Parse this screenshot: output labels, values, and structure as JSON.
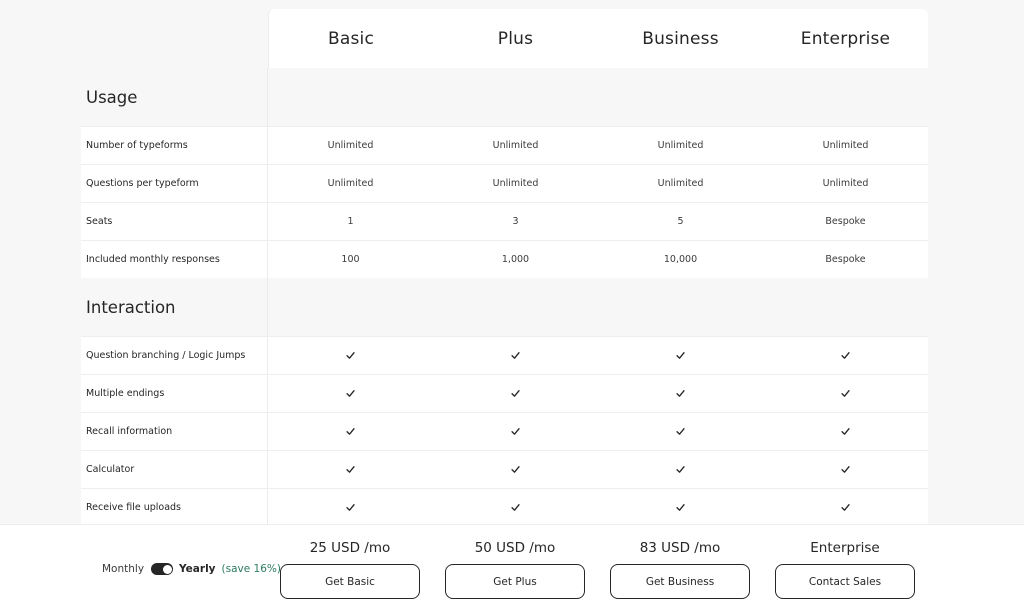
{
  "plans": [
    "Basic",
    "Plus",
    "Business",
    "Enterprise"
  ],
  "sections": [
    {
      "title": "Usage",
      "rows": [
        {
          "label": "Number of typeforms",
          "values": [
            "Unlimited",
            "Unlimited",
            "Unlimited",
            "Unlimited"
          ]
        },
        {
          "label": "Questions per typeform",
          "values": [
            "Unlimited",
            "Unlimited",
            "Unlimited",
            "Unlimited"
          ]
        },
        {
          "label": "Seats",
          "values": [
            "1",
            "3",
            "5",
            "Bespoke"
          ]
        },
        {
          "label": "Included monthly responses",
          "values": [
            "100",
            "1,000",
            "10,000",
            "Bespoke"
          ]
        }
      ]
    },
    {
      "title": "Interaction",
      "rows": [
        {
          "label": "Question branching / Logic Jumps",
          "values": [
            "check",
            "check",
            "check",
            "check"
          ]
        },
        {
          "label": "Multiple endings",
          "values": [
            "check",
            "check",
            "check",
            "check"
          ]
        },
        {
          "label": "Recall information",
          "values": [
            "check",
            "check",
            "check",
            "check"
          ]
        },
        {
          "label": "Calculator",
          "values": [
            "check",
            "check",
            "check",
            "check"
          ]
        },
        {
          "label": "Receive file uploads",
          "values": [
            "check",
            "check",
            "check",
            "check"
          ]
        }
      ]
    }
  ],
  "billing": {
    "monthly_label": "Monthly",
    "yearly_label": "Yearly",
    "save_label": "(save 16%)",
    "selected": "yearly"
  },
  "cta": [
    {
      "price": "25 USD /mo",
      "button": "Get Basic"
    },
    {
      "price": "50 USD /mo",
      "button": "Get Plus"
    },
    {
      "price": "83 USD /mo",
      "button": "Get Business"
    },
    {
      "price": "Enterprise",
      "button": "Contact Sales"
    }
  ],
  "colors": {
    "background": "#f7f7f7",
    "text": "#262627",
    "accent_green": "#2c7b62",
    "toggle_on": "#262627"
  },
  "icons": {
    "check": "checkmark-icon"
  }
}
